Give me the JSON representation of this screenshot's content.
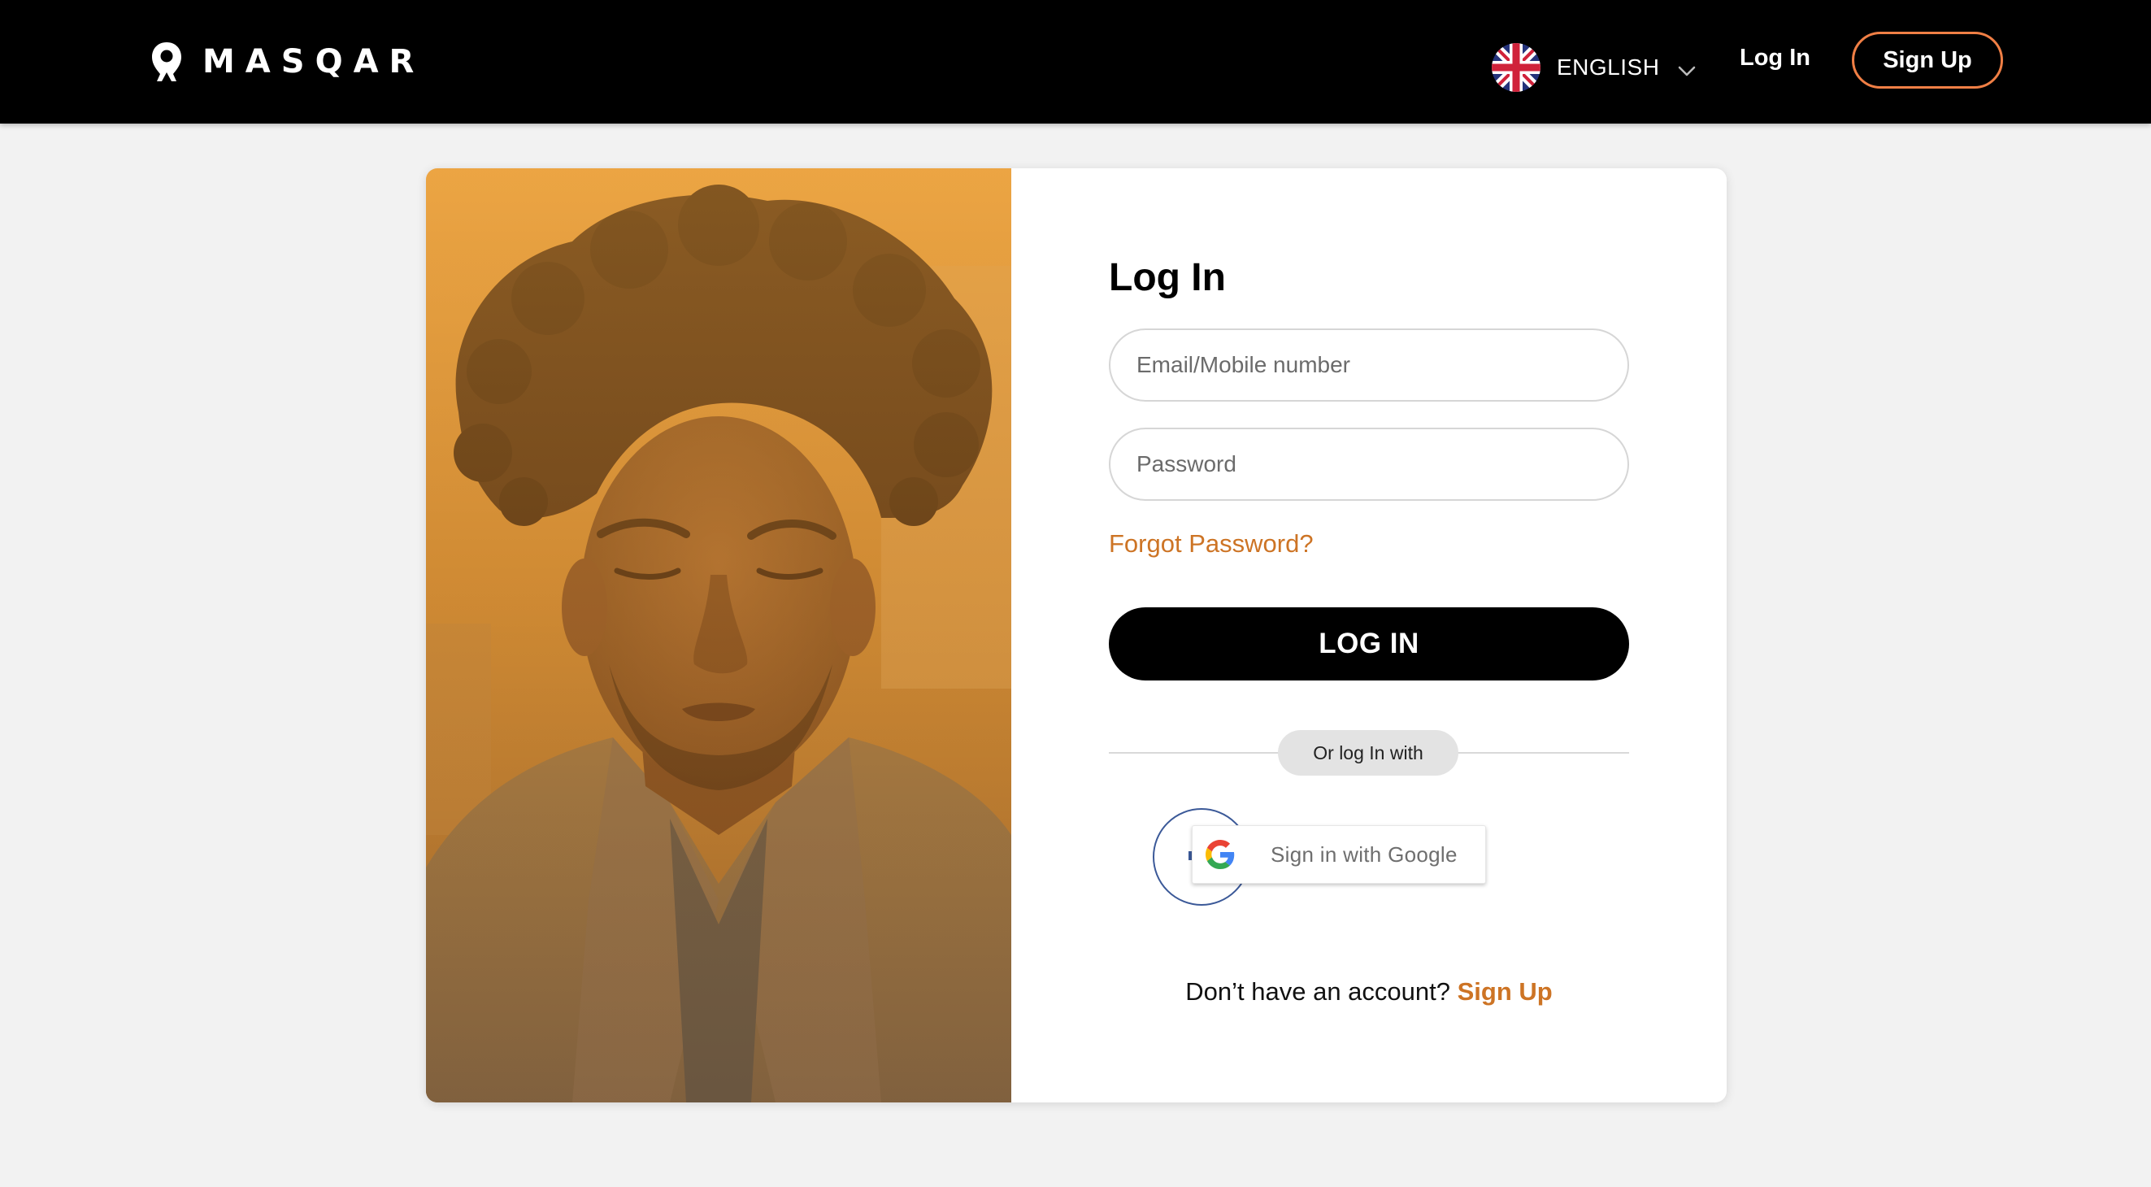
{
  "header": {
    "brand_name": "MASQAR",
    "brand_icon": "location-pin-icon",
    "language": {
      "label": "ENGLISH",
      "flag_icon": "uk-flag-icon"
    },
    "login_label": "Log In",
    "signup_label": "Sign Up"
  },
  "login": {
    "title": "Log In",
    "email_placeholder": "Email/Mobile number",
    "email_value": "",
    "password_placeholder": "Password",
    "password_value": "",
    "forgot_label": "Forgot Password?",
    "submit_label": "LOG IN",
    "divider_label": "Or log In with",
    "facebook_icon": "facebook-icon",
    "google_label": "Sign in with Google",
    "google_icon": "google-g-icon",
    "signup_prompt": "Don’t have an account?",
    "signup_link": "Sign Up"
  },
  "colors": {
    "header_bg": "#000000",
    "page_bg": "#f2f2f2",
    "accent_orange": "#cd7425",
    "signup_border": "#f07f45",
    "facebook_blue": "#3b5998",
    "button_black": "#000000"
  }
}
